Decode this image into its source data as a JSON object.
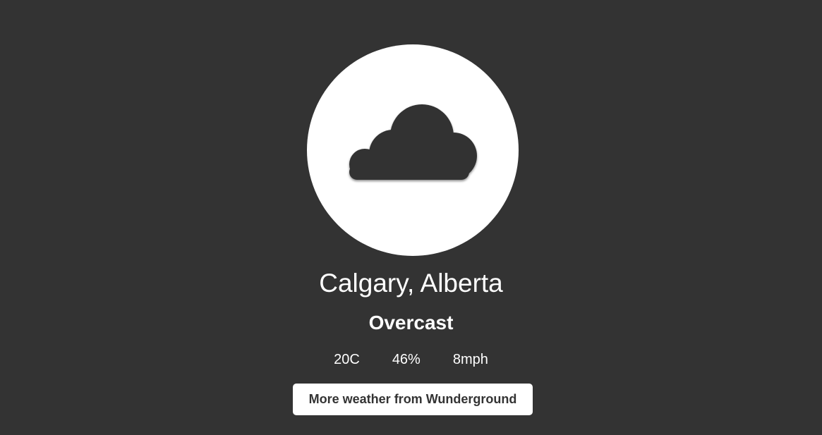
{
  "weather": {
    "icon": "cloud-icon",
    "location": "Calgary, Alberta",
    "condition": "Overcast",
    "temperature": "20C",
    "humidity": "46%",
    "wind": "8mph"
  },
  "actions": {
    "more_label": "More weather from Wunderground"
  },
  "colors": {
    "background": "#333333",
    "circle": "#ffffff",
    "cloud": "#333333",
    "text": "#ffffff"
  }
}
